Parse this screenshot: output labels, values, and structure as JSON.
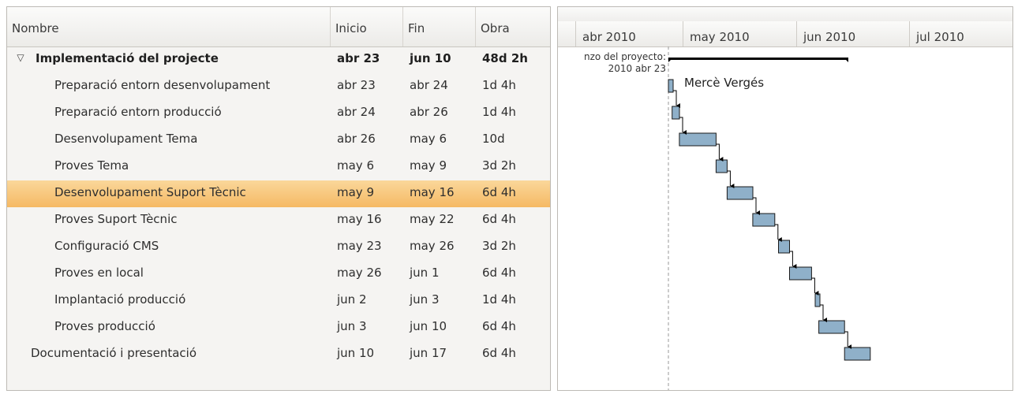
{
  "table": {
    "columns": [
      "Nombre",
      "Inicio",
      "Fin",
      "Obra"
    ],
    "rows": [
      {
        "name": "Implementació del projecte",
        "start": "abr 23",
        "end": "jun 10",
        "work": "48d 2h",
        "level": 0,
        "bold": true,
        "expander": true
      },
      {
        "name": "Preparació entorn desenvolupament",
        "start": "abr 23",
        "end": "abr 24",
        "work": "1d 4h",
        "level": 1
      },
      {
        "name": "Preparació entorn producció",
        "start": "abr 24",
        "end": "abr 26",
        "work": "1d 4h",
        "level": 1
      },
      {
        "name": "Desenvolupament Tema",
        "start": "abr 26",
        "end": "may 6",
        "work": "10d",
        "level": 1
      },
      {
        "name": "Proves Tema",
        "start": "may 6",
        "end": "may 9",
        "work": "3d 2h",
        "level": 1
      },
      {
        "name": "Desenvolupament Suport Tècnic",
        "start": "may 9",
        "end": "may 16",
        "work": "6d 4h",
        "level": 1,
        "selected": true
      },
      {
        "name": "Proves Suport Tècnic",
        "start": "may 16",
        "end": "may 22",
        "work": "6d 4h",
        "level": 1
      },
      {
        "name": "Configuració CMS",
        "start": "may 23",
        "end": "may 26",
        "work": "3d 2h",
        "level": 1
      },
      {
        "name": "Proves en local",
        "start": "may 26",
        "end": "jun 1",
        "work": "6d 4h",
        "level": 1
      },
      {
        "name": "Implantació producció",
        "start": "jun 2",
        "end": "jun 3",
        "work": "1d 4h",
        "level": 1
      },
      {
        "name": "Proves producció",
        "start": "jun 3",
        "end": "jun 10",
        "work": "6d 4h",
        "level": 1
      },
      {
        "name": "Documentació i presentació",
        "start": "jun 10",
        "end": "jun 17",
        "work": "6d 4h",
        "level": 0
      }
    ]
  },
  "gantt": {
    "months": [
      "abr 2010",
      "may 2010",
      "jun 2010",
      "jul 2010"
    ],
    "project_start_label_line1": "nzo del proyecto:",
    "project_start_label_line2": "2010 abr 23",
    "resource_label": "Mercè Vergés",
    "colors": {
      "bar_fill": "#8fb0c9",
      "bar_stroke": "#1a1a1a",
      "selected_row": "#f7c47c",
      "summary_bar": "#000000"
    }
  }
}
